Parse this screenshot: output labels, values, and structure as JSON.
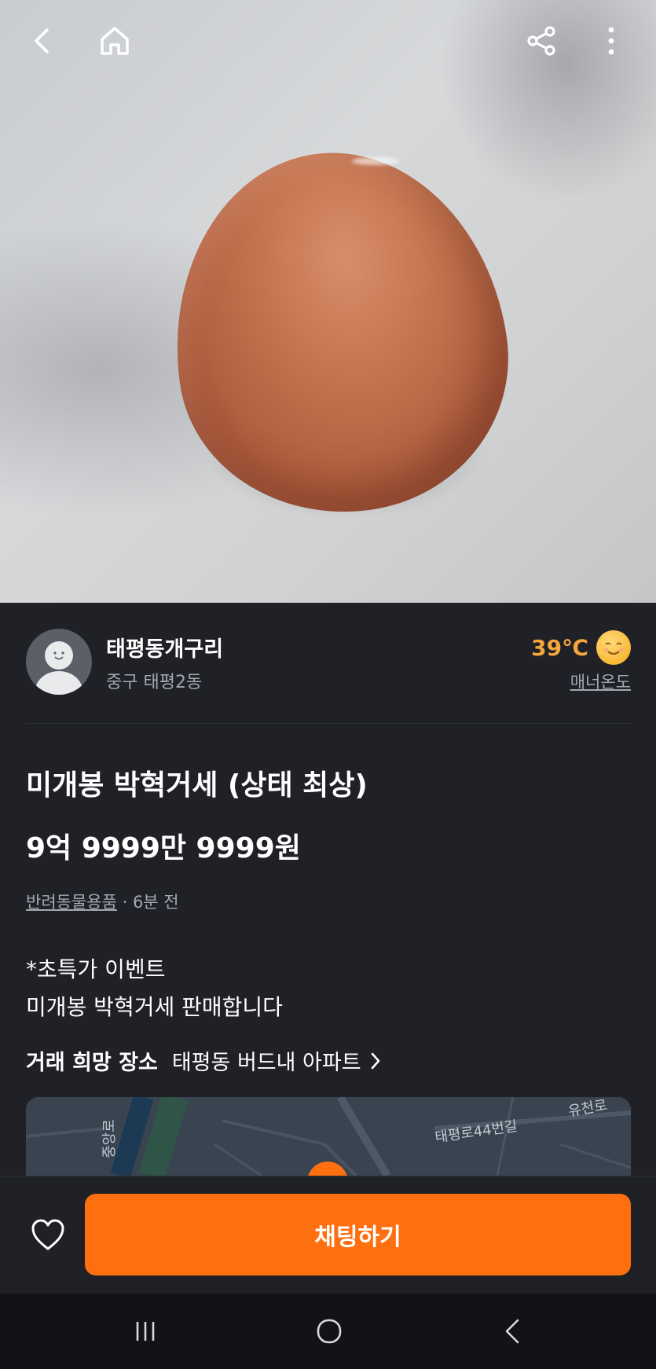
{
  "icons": {
    "back": "chevron-left-icon",
    "home": "home-icon",
    "share": "share-icon",
    "more": "more-vertical-icon",
    "heart": "heart-icon"
  },
  "colors": {
    "accent": "#fe6f0f",
    "temperature": "#f5a63d",
    "background": "#1f2127"
  },
  "seller": {
    "name": "태평동개구리",
    "location": "중구 태평2동",
    "temperature": "39℃",
    "temperature_label": "매너온도"
  },
  "item": {
    "title": "미개봉 박혁거세 (상태 최상)",
    "price": "9억 9999만 9999원",
    "category": "반려동물용품",
    "time": " · 6분 전",
    "description_lines": [
      "*초특가 이벤트",
      "미개봉 박혁거세 판매합니다"
    ]
  },
  "trade_place": {
    "label": "거래 희망 장소",
    "value": "태평동 버드내 아파트"
  },
  "map": {
    "road_labels": [
      "태평로44번길",
      "중앙로",
      "유천로"
    ]
  },
  "bottom_bar": {
    "chat_button": "채팅하기"
  }
}
